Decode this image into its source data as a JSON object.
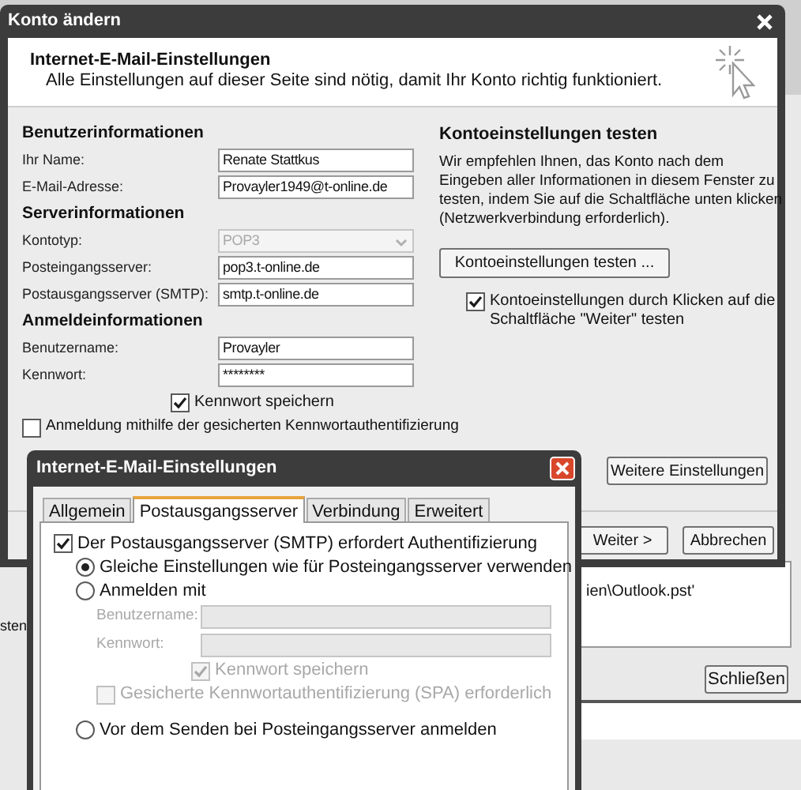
{
  "main_window": {
    "title": "Konto ändern",
    "header": {
      "title": "Internet-E-Mail-Einstellungen",
      "subtitle": "Alle Einstellungen auf dieser Seite sind nötig, damit Ihr Konto richtig funktioniert."
    },
    "sections": [
      {
        "heading": "Benutzerinformationen",
        "fields": [
          {
            "kind": "text",
            "label": "Ihr Name:",
            "value": "Renate Stattkus",
            "disabled": false
          },
          {
            "kind": "text",
            "label": "E-Mail-Adresse:",
            "value": "Provayler1949@t-online.de",
            "disabled": false
          }
        ]
      },
      {
        "heading": "Serverinformationen",
        "fields": [
          {
            "kind": "dropdown",
            "label": "Kontotyp:",
            "value": "POP3",
            "disabled": true
          },
          {
            "kind": "text",
            "label": "Posteingangsserver:",
            "value": "pop3.t-online.de",
            "disabled": false
          },
          {
            "kind": "text",
            "label": "Postausgangsserver (SMTP):",
            "value": "smtp.t-online.de",
            "disabled": false
          }
        ]
      },
      {
        "heading": "Anmeldeinformationen",
        "fields": [
          {
            "kind": "text",
            "label": "Benutzername:",
            "value": "Provayler",
            "disabled": false
          },
          {
            "kind": "text",
            "label": "Kennwort:",
            "value": "********",
            "disabled": false
          }
        ]
      }
    ],
    "save_password": {
      "label": "Kennwort speichern",
      "checked": true
    },
    "spa_login": {
      "label": "Anmeldung mithilfe der gesicherten Kennwortauthentifizierung",
      "checked": false
    },
    "test_section": {
      "heading": "Kontoeinstellungen testen",
      "description": "Wir empfehlen Ihnen, das Konto nach dem Eingeben aller Informationen in diesem Fenster zu testen, indem Sie auf die Schaltfläche unten klicken (Netzwerkverbindung erforderlich).",
      "test_button": "Kontoeinstellungen testen ...",
      "auto_test": {
        "label": "Kontoeinstellungen durch Klicken auf die Schaltfläche \"Weiter\" testen",
        "checked": true
      }
    },
    "more_settings_button": "Weitere Einstellungen",
    "buttons": [
      "Weiter >",
      "Abbrechen"
    ]
  },
  "settings_dialog": {
    "title": "Internet-E-Mail-Einstellungen",
    "tabs": [
      {
        "label": "Allgemein",
        "selected": false
      },
      {
        "label": "Postausgangsserver",
        "selected": true
      },
      {
        "label": "Verbindung",
        "selected": false
      },
      {
        "label": "Erweitert",
        "selected": false
      }
    ],
    "smtp_auth": {
      "label": "Der Postausgangsserver (SMTP) erfordert Authentifizierung",
      "checked": true
    },
    "items": [
      {
        "kind": "radio",
        "label": "Gleiche Einstellungen wie für Posteingangsserver verwenden",
        "selected": true
      },
      {
        "kind": "radio",
        "label": "Anmelden mit",
        "selected": false
      },
      {
        "kind": "field",
        "label": "Benutzername:",
        "disabled": true
      },
      {
        "kind": "field",
        "label": "Kennwort:",
        "disabled": true
      },
      {
        "kind": "checkbox",
        "label": "Kennwort speichern",
        "checked": true,
        "disabled": true
      },
      {
        "kind": "checkbox",
        "label": "Gesicherte Kennwortauthentifizierung (SPA) erforderlich",
        "checked": false,
        "disabled": true
      },
      {
        "kind": "radio",
        "label": "Vor dem Senden bei Posteingangsserver anmelden",
        "selected": false
      }
    ]
  },
  "background_window": {
    "left_text": "sten",
    "path_text": "ien\\Outlook.pst'",
    "close_button": "Schließen"
  }
}
